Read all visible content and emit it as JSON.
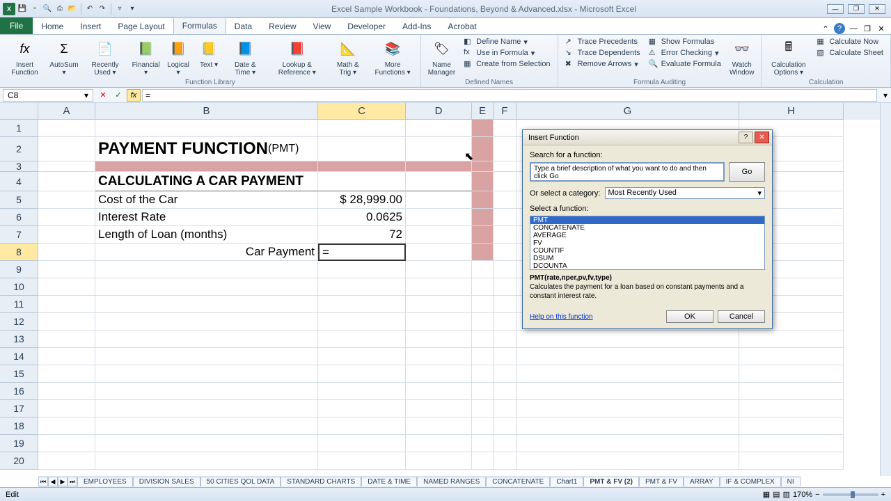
{
  "title": "Excel Sample Workbook - Foundations, Beyond & Advanced.xlsx - Microsoft Excel",
  "tabs": [
    "Home",
    "Insert",
    "Page Layout",
    "Formulas",
    "Data",
    "Review",
    "View",
    "Developer",
    "Add-Ins",
    "Acrobat"
  ],
  "active_tab": "Formulas",
  "file_tab": "File",
  "ribbon": {
    "g1": {
      "label": "Function Library",
      "btns": [
        "Insert\nFunction",
        "AutoSum",
        "Recently\nUsed",
        "Financial",
        "Logical",
        "Text",
        "Date &\nTime",
        "Lookup &\nReference",
        "Math\n& Trig",
        "More\nFunctions"
      ]
    },
    "g2": {
      "label": "Defined Names",
      "big": "Name\nManager",
      "items": [
        "Define Name",
        "Use in Formula",
        "Create from Selection"
      ]
    },
    "g3": {
      "label": "Formula Auditing",
      "col1": [
        "Trace Precedents",
        "Trace Dependents",
        "Remove Arrows"
      ],
      "col2": [
        "Show Formulas",
        "Error Checking",
        "Evaluate Formula"
      ],
      "big": "Watch\nWindow"
    },
    "g4": {
      "label": "Calculation",
      "big": "Calculation\nOptions",
      "items": [
        "Calculate Now",
        "Calculate Sheet"
      ]
    }
  },
  "namebox": "C8",
  "formula": "=",
  "cols": [
    "A",
    "B",
    "C",
    "D",
    "E",
    "F",
    "G",
    "H"
  ],
  "sheet": {
    "title": "PAYMENT FUNCTION",
    "subtitle": "(PMT)",
    "section": "CALCULATING A CAR PAYMENT",
    "r5l": "Cost of the Car",
    "r5v": "$ 28,999.00",
    "r6l": "Interest Rate",
    "r6v": "0.0625",
    "r7l": "Length of Loan (months)",
    "r7v": "72",
    "r8l": "Car Payment",
    "r8v": "="
  },
  "dialog": {
    "title": "Insert Function",
    "search_label": "Search for a function:",
    "search_value": "Type a brief description of what you want to do and then click Go",
    "go": "Go",
    "cat_label": "Or select a category:",
    "cat_value": "Most Recently Used",
    "select_label": "Select a function:",
    "list": [
      "PMT",
      "CONCATENATE",
      "AVERAGE",
      "FV",
      "COUNTIF",
      "DSUM",
      "DCOUNTA"
    ],
    "syntax": "PMT(rate,nper,pv,fv,type)",
    "desc": "Calculates the payment for a loan based on constant payments and a constant interest rate.",
    "help": "Help on this function",
    "ok": "OK",
    "cancel": "Cancel"
  },
  "sheets": [
    "EMPLOYEES",
    "DIVISION SALES",
    "50 CITIES QOL DATA",
    "STANDARD CHARTS",
    "DATE & TIME",
    "NAMED RANGES",
    "CONCATENATE",
    "Chart1",
    "PMT & FV (2)",
    "PMT & FV",
    "ARRAY",
    "IF & COMPLEX",
    "NI"
  ],
  "active_sheet": "PMT & FV (2)",
  "status": "Edit",
  "zoom": "170%"
}
